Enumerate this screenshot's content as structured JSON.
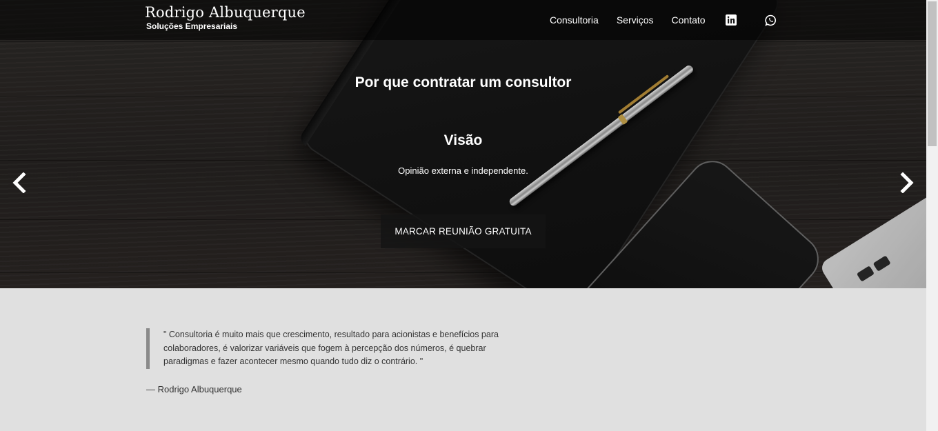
{
  "header": {
    "brand_name": "Rodrigo Albuquerque",
    "brand_sub": "Soluções Empresariais",
    "nav": [
      {
        "label": "Consultoria"
      },
      {
        "label": "Serviços"
      },
      {
        "label": "Contato"
      }
    ],
    "icons": {
      "linkedin": "linkedin-icon",
      "whatsapp": "whatsapp-icon"
    }
  },
  "hero": {
    "title": "Por que contratar um consultor",
    "slide_title": "Visão",
    "slide_text": "Opinião externa e independente.",
    "cta_label": "MARCAR REUNIÃO GRATUITA",
    "prev_icon": "chevron-left-icon",
    "next_icon": "chevron-right-icon"
  },
  "quote": {
    "text": "\" Consultoria é muito mais que crescimento, resultado para acionistas e benefícios para colaboradores, é valorizar variáveis que fogem à percepção dos números, é quebrar paradigmas e fazer acontecer mesmo quando tudo diz o contrário. \"",
    "author": "— Rodrigo Albuquerque"
  },
  "colors": {
    "header_bg": "#000000",
    "hero_bg": "#2a2624",
    "quote_bg": "#e0e0e0",
    "quote_border": "#8a8a8a",
    "text_dark": "#333333"
  }
}
